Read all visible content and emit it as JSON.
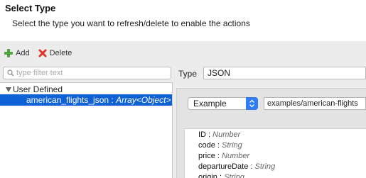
{
  "header": {
    "title": "Select Type",
    "subtitle": "Select the type you want to refresh/delete to enable the actions"
  },
  "toolbar": {
    "add_label": "Add",
    "delete_label": "Delete"
  },
  "filter": {
    "placeholder": "type filter text",
    "value": ""
  },
  "tree": {
    "root_label": "User Defined",
    "items": [
      {
        "name": "american_flights_json",
        "sep": " : ",
        "type": "Array<Object>",
        "selected": true
      }
    ]
  },
  "type_panel": {
    "label": "Type",
    "value": "JSON"
  },
  "example": {
    "select_value": "Example",
    "path_value": "examples/american-flights"
  },
  "schema_fields": [
    {
      "name": "ID",
      "sep": " : ",
      "type": "Number"
    },
    {
      "name": "code",
      "sep": " : ",
      "type": "String"
    },
    {
      "name": "price",
      "sep": " : ",
      "type": "Number"
    },
    {
      "name": "departureDate",
      "sep": " : ",
      "type": "String"
    },
    {
      "name": "origin",
      "sep": " : ",
      "type": "String"
    }
  ],
  "colors": {
    "selection": "#0f62d6",
    "add_icon": "#4caf3a",
    "delete_icon": "#e0352b",
    "select_arrows": "#2f7df6"
  }
}
